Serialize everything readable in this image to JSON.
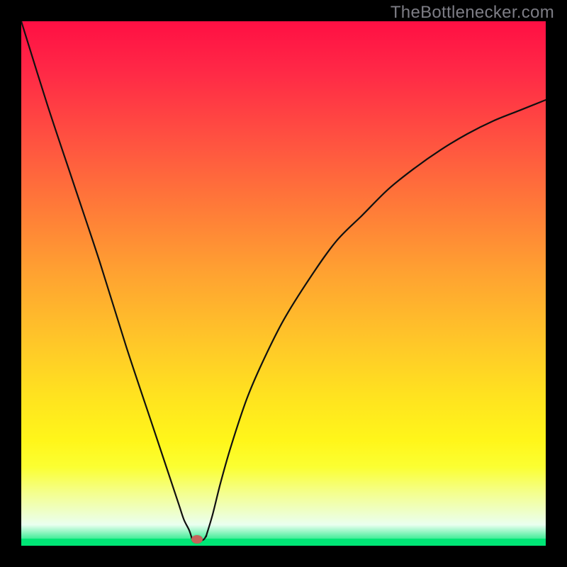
{
  "watermark": "TheBottlenecker.com",
  "marker": {
    "x_pct": 33.5,
    "y_pct": 98.8
  },
  "colors": {
    "frame": "#000000",
    "curve": "#101010",
    "marker": "#c6645a",
    "gradient_top": "#ff0f44",
    "gradient_bottom": "#00e676"
  },
  "chart_data": {
    "type": "line",
    "title": "",
    "xlabel": "",
    "ylabel": "",
    "xlim": [
      0,
      100
    ],
    "ylim": [
      0,
      100
    ],
    "annotations": [
      {
        "text": "TheBottlenecker.com",
        "position": "top-right"
      }
    ],
    "series": [
      {
        "name": "left-branch",
        "x": [
          0,
          5,
          10,
          15,
          20,
          25,
          28,
          30,
          31,
          32,
          32.5
        ],
        "y": [
          100,
          84,
          69,
          54,
          38,
          23,
          14,
          8,
          5,
          3,
          1.5
        ]
      },
      {
        "name": "valley-floor",
        "x": [
          32.5,
          33,
          34,
          34.8,
          35.3
        ],
        "y": [
          1.5,
          1.2,
          1.0,
          1.2,
          2.0
        ]
      },
      {
        "name": "right-branch",
        "x": [
          35.3,
          36.5,
          38,
          40,
          43,
          46,
          50,
          55,
          60,
          65,
          70,
          75,
          80,
          85,
          90,
          95,
          100
        ],
        "y": [
          2.0,
          6,
          12,
          19,
          28,
          35,
          43,
          51,
          58,
          63,
          68,
          72,
          75.5,
          78.5,
          81,
          83,
          85
        ]
      }
    ],
    "marker_point": {
      "x": 33.5,
      "y": 1.2
    },
    "background_gradient": {
      "orientation": "vertical",
      "stops": [
        {
          "pos": 0.0,
          "color": "#ff0f44"
        },
        {
          "pos": 0.36,
          "color": "#ff7c38"
        },
        {
          "pos": 0.62,
          "color": "#ffc928"
        },
        {
          "pos": 0.85,
          "color": "#fbff32"
        },
        {
          "pos": 0.997,
          "color": "#00e676"
        }
      ]
    }
  }
}
